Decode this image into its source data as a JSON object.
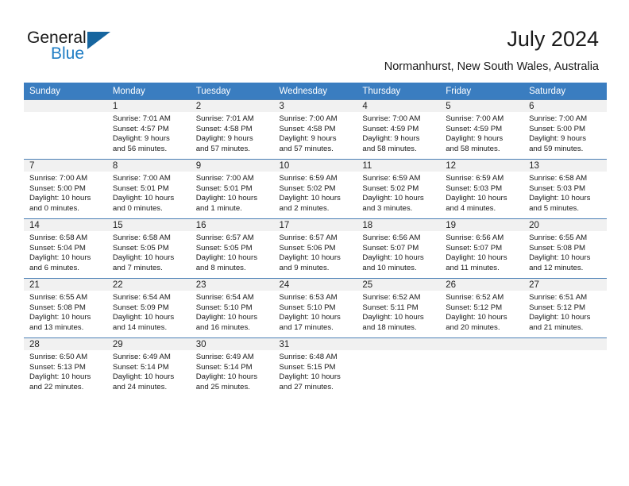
{
  "brand": {
    "name_part1": "General",
    "name_part2": "Blue",
    "accent_color": "#1f7dc4",
    "flag_color": "#16659f"
  },
  "header": {
    "title": "July 2024",
    "location": "Normanhurst, New South Wales, Australia"
  },
  "theme": {
    "header_row_bg": "#3a7dc0",
    "daynum_bg": "#f1f1f1",
    "grid_line": "#4a7fb5",
    "text": "#1a1a1a"
  },
  "calendar": {
    "weekday_headers": [
      "Sunday",
      "Monday",
      "Tuesday",
      "Wednesday",
      "Thursday",
      "Friday",
      "Saturday"
    ],
    "weeks": [
      [
        {
          "day": "",
          "sunrise": "",
          "sunset": "",
          "daylight_line1": "",
          "daylight_line2": ""
        },
        {
          "day": "1",
          "sunrise": "Sunrise: 7:01 AM",
          "sunset": "Sunset: 4:57 PM",
          "daylight_line1": "Daylight: 9 hours",
          "daylight_line2": "and 56 minutes."
        },
        {
          "day": "2",
          "sunrise": "Sunrise: 7:01 AM",
          "sunset": "Sunset: 4:58 PM",
          "daylight_line1": "Daylight: 9 hours",
          "daylight_line2": "and 57 minutes."
        },
        {
          "day": "3",
          "sunrise": "Sunrise: 7:00 AM",
          "sunset": "Sunset: 4:58 PM",
          "daylight_line1": "Daylight: 9 hours",
          "daylight_line2": "and 57 minutes."
        },
        {
          "day": "4",
          "sunrise": "Sunrise: 7:00 AM",
          "sunset": "Sunset: 4:59 PM",
          "daylight_line1": "Daylight: 9 hours",
          "daylight_line2": "and 58 minutes."
        },
        {
          "day": "5",
          "sunrise": "Sunrise: 7:00 AM",
          "sunset": "Sunset: 4:59 PM",
          "daylight_line1": "Daylight: 9 hours",
          "daylight_line2": "and 58 minutes."
        },
        {
          "day": "6",
          "sunrise": "Sunrise: 7:00 AM",
          "sunset": "Sunset: 5:00 PM",
          "daylight_line1": "Daylight: 9 hours",
          "daylight_line2": "and 59 minutes."
        }
      ],
      [
        {
          "day": "7",
          "sunrise": "Sunrise: 7:00 AM",
          "sunset": "Sunset: 5:00 PM",
          "daylight_line1": "Daylight: 10 hours",
          "daylight_line2": "and 0 minutes."
        },
        {
          "day": "8",
          "sunrise": "Sunrise: 7:00 AM",
          "sunset": "Sunset: 5:01 PM",
          "daylight_line1": "Daylight: 10 hours",
          "daylight_line2": "and 0 minutes."
        },
        {
          "day": "9",
          "sunrise": "Sunrise: 7:00 AM",
          "sunset": "Sunset: 5:01 PM",
          "daylight_line1": "Daylight: 10 hours",
          "daylight_line2": "and 1 minute."
        },
        {
          "day": "10",
          "sunrise": "Sunrise: 6:59 AM",
          "sunset": "Sunset: 5:02 PM",
          "daylight_line1": "Daylight: 10 hours",
          "daylight_line2": "and 2 minutes."
        },
        {
          "day": "11",
          "sunrise": "Sunrise: 6:59 AM",
          "sunset": "Sunset: 5:02 PM",
          "daylight_line1": "Daylight: 10 hours",
          "daylight_line2": "and 3 minutes."
        },
        {
          "day": "12",
          "sunrise": "Sunrise: 6:59 AM",
          "sunset": "Sunset: 5:03 PM",
          "daylight_line1": "Daylight: 10 hours",
          "daylight_line2": "and 4 minutes."
        },
        {
          "day": "13",
          "sunrise": "Sunrise: 6:58 AM",
          "sunset": "Sunset: 5:03 PM",
          "daylight_line1": "Daylight: 10 hours",
          "daylight_line2": "and 5 minutes."
        }
      ],
      [
        {
          "day": "14",
          "sunrise": "Sunrise: 6:58 AM",
          "sunset": "Sunset: 5:04 PM",
          "daylight_line1": "Daylight: 10 hours",
          "daylight_line2": "and 6 minutes."
        },
        {
          "day": "15",
          "sunrise": "Sunrise: 6:58 AM",
          "sunset": "Sunset: 5:05 PM",
          "daylight_line1": "Daylight: 10 hours",
          "daylight_line2": "and 7 minutes."
        },
        {
          "day": "16",
          "sunrise": "Sunrise: 6:57 AM",
          "sunset": "Sunset: 5:05 PM",
          "daylight_line1": "Daylight: 10 hours",
          "daylight_line2": "and 8 minutes."
        },
        {
          "day": "17",
          "sunrise": "Sunrise: 6:57 AM",
          "sunset": "Sunset: 5:06 PM",
          "daylight_line1": "Daylight: 10 hours",
          "daylight_line2": "and 9 minutes."
        },
        {
          "day": "18",
          "sunrise": "Sunrise: 6:56 AM",
          "sunset": "Sunset: 5:07 PM",
          "daylight_line1": "Daylight: 10 hours",
          "daylight_line2": "and 10 minutes."
        },
        {
          "day": "19",
          "sunrise": "Sunrise: 6:56 AM",
          "sunset": "Sunset: 5:07 PM",
          "daylight_line1": "Daylight: 10 hours",
          "daylight_line2": "and 11 minutes."
        },
        {
          "day": "20",
          "sunrise": "Sunrise: 6:55 AM",
          "sunset": "Sunset: 5:08 PM",
          "daylight_line1": "Daylight: 10 hours",
          "daylight_line2": "and 12 minutes."
        }
      ],
      [
        {
          "day": "21",
          "sunrise": "Sunrise: 6:55 AM",
          "sunset": "Sunset: 5:08 PM",
          "daylight_line1": "Daylight: 10 hours",
          "daylight_line2": "and 13 minutes."
        },
        {
          "day": "22",
          "sunrise": "Sunrise: 6:54 AM",
          "sunset": "Sunset: 5:09 PM",
          "daylight_line1": "Daylight: 10 hours",
          "daylight_line2": "and 14 minutes."
        },
        {
          "day": "23",
          "sunrise": "Sunrise: 6:54 AM",
          "sunset": "Sunset: 5:10 PM",
          "daylight_line1": "Daylight: 10 hours",
          "daylight_line2": "and 16 minutes."
        },
        {
          "day": "24",
          "sunrise": "Sunrise: 6:53 AM",
          "sunset": "Sunset: 5:10 PM",
          "daylight_line1": "Daylight: 10 hours",
          "daylight_line2": "and 17 minutes."
        },
        {
          "day": "25",
          "sunrise": "Sunrise: 6:52 AM",
          "sunset": "Sunset: 5:11 PM",
          "daylight_line1": "Daylight: 10 hours",
          "daylight_line2": "and 18 minutes."
        },
        {
          "day": "26",
          "sunrise": "Sunrise: 6:52 AM",
          "sunset": "Sunset: 5:12 PM",
          "daylight_line1": "Daylight: 10 hours",
          "daylight_line2": "and 20 minutes."
        },
        {
          "day": "27",
          "sunrise": "Sunrise: 6:51 AM",
          "sunset": "Sunset: 5:12 PM",
          "daylight_line1": "Daylight: 10 hours",
          "daylight_line2": "and 21 minutes."
        }
      ],
      [
        {
          "day": "28",
          "sunrise": "Sunrise: 6:50 AM",
          "sunset": "Sunset: 5:13 PM",
          "daylight_line1": "Daylight: 10 hours",
          "daylight_line2": "and 22 minutes."
        },
        {
          "day": "29",
          "sunrise": "Sunrise: 6:49 AM",
          "sunset": "Sunset: 5:14 PM",
          "daylight_line1": "Daylight: 10 hours",
          "daylight_line2": "and 24 minutes."
        },
        {
          "day": "30",
          "sunrise": "Sunrise: 6:49 AM",
          "sunset": "Sunset: 5:14 PM",
          "daylight_line1": "Daylight: 10 hours",
          "daylight_line2": "and 25 minutes."
        },
        {
          "day": "31",
          "sunrise": "Sunrise: 6:48 AM",
          "sunset": "Sunset: 5:15 PM",
          "daylight_line1": "Daylight: 10 hours",
          "daylight_line2": "and 27 minutes."
        },
        {
          "day": "",
          "sunrise": "",
          "sunset": "",
          "daylight_line1": "",
          "daylight_line2": ""
        },
        {
          "day": "",
          "sunrise": "",
          "sunset": "",
          "daylight_line1": "",
          "daylight_line2": ""
        },
        {
          "day": "",
          "sunrise": "",
          "sunset": "",
          "daylight_line1": "",
          "daylight_line2": ""
        }
      ]
    ]
  }
}
